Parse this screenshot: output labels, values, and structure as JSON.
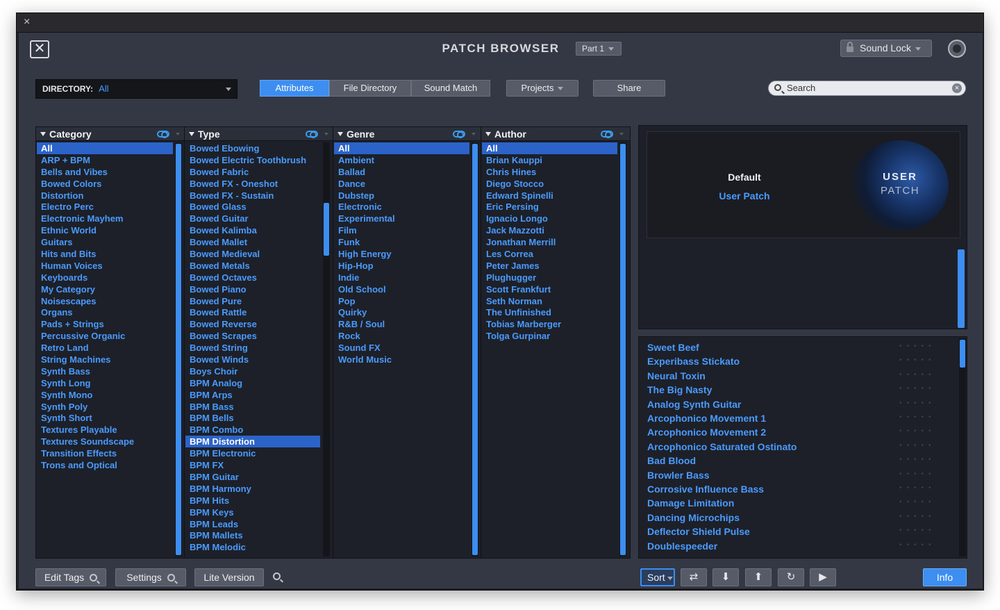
{
  "window": {
    "close_glyph": "×"
  },
  "header": {
    "title": "PATCH BROWSER",
    "part_selector": "Part 1",
    "sound_lock": "Sound Lock",
    "close_icon": "close-icon",
    "power_icon": "power-icon"
  },
  "directory": {
    "label": "DIRECTORY:",
    "value": "All"
  },
  "tabs": [
    {
      "label": "Attributes",
      "active": true
    },
    {
      "label": "File Directory",
      "active": false
    },
    {
      "label": "Sound Match",
      "active": false
    }
  ],
  "toolbar": {
    "projects": "Projects",
    "share": "Share"
  },
  "search": {
    "placeholder": "Search",
    "clear_glyph": "×"
  },
  "columns": {
    "category": {
      "header": "Category",
      "items": [
        "All",
        "ARP + BPM",
        "Bells and Vibes",
        "Bowed Colors",
        "Distortion",
        "Electro Perc",
        "Electronic Mayhem",
        "Ethnic World",
        "Guitars",
        "Hits and Bits",
        "Human Voices",
        "Keyboards",
        "My Category",
        "Noisescapes",
        "Organs",
        "Pads + Strings",
        "Percussive Organic",
        "Retro Land",
        "String Machines",
        "Synth Bass",
        "Synth Long",
        "Synth Mono",
        "Synth Poly",
        "Synth Short",
        "Textures Playable",
        "Textures Soundscape",
        "Transition Effects",
        "Trons and Optical"
      ],
      "selected": "All"
    },
    "type": {
      "header": "Type",
      "items": [
        "Bowed Ebowing",
        "Bowed Electric Toothbrush",
        "Bowed Fabric",
        "Bowed FX - Oneshot",
        "Bowed FX - Sustain",
        "Bowed Glass",
        "Bowed Guitar",
        "Bowed Kalimba",
        "Bowed Mallet",
        "Bowed Medieval",
        "Bowed Metals",
        "Bowed Octaves",
        "Bowed Piano",
        "Bowed Pure",
        "Bowed Rattle",
        "Bowed Reverse",
        "Bowed Scrapes",
        "Bowed String",
        "Bowed Winds",
        "Boys Choir",
        "BPM Analog",
        "BPM Arps",
        "BPM Bass",
        "BPM Bells",
        "BPM Combo",
        "BPM Distortion",
        "BPM Electronic",
        "BPM FX",
        "BPM Guitar",
        "BPM Harmony",
        "BPM Hits",
        "BPM Keys",
        "BPM Leads",
        "BPM Mallets",
        "BPM Melodic"
      ],
      "selected": "BPM Distortion"
    },
    "genre": {
      "header": "Genre",
      "items": [
        "All",
        "Ambient",
        "Ballad",
        "Dance",
        "Dubstep",
        "Electronic",
        "Experimental",
        "Film",
        "Funk",
        "High Energy",
        "Hip-Hop",
        "Indie",
        "Old School",
        "Pop",
        "Quirky",
        "R&B / Soul",
        "Rock",
        "Sound FX",
        "World Music"
      ],
      "selected": "All"
    },
    "author": {
      "header": "Author",
      "items": [
        "All",
        "Brian Kauppi",
        "Chris Hines",
        "Diego Stocco",
        "Edward Spinelli",
        "Eric Persing",
        "Ignacio Longo",
        "Jack Mazzotti",
        "Jonathan Merrill",
        "Les Correa",
        "Peter James",
        "Plughugger",
        "Scott Frankfurt",
        "Seth Norman",
        "The Unfinished",
        "Tobias Marberger",
        "Tolga Gurpinar"
      ],
      "selected": "All"
    }
  },
  "preview": {
    "title": "Default",
    "subtitle": "User Patch",
    "logo_line1": "USER",
    "logo_line2": "PATCH"
  },
  "patches": [
    "Sweet Beef",
    "Experibass Stickato",
    "Neural Toxin",
    "The Big Nasty",
    "Analog Synth Guitar",
    "Arcophonico Movement 1",
    "Arcophonico Movement 2",
    "Arcophonico Saturated Ostinato",
    "Bad Blood",
    "Browler Bass",
    "Corrosive Influence Bass",
    "Damage Limitation",
    "Dancing Microchips",
    "Deflector Shield Pulse",
    "Doublespeeder"
  ],
  "bottom": {
    "edit_tags": "Edit Tags",
    "settings": "Settings",
    "lite_version": "Lite Version",
    "sort": "Sort",
    "info": "Info",
    "icons": [
      "shuffle-icon",
      "arrow-down-icon",
      "arrow-up-icon",
      "refresh-icon",
      "play-icon"
    ]
  },
  "colors": {
    "accent": "#3d8ef0",
    "link_text": "#4a9bff",
    "panel": "#1d2028",
    "chrome": "#343844"
  }
}
